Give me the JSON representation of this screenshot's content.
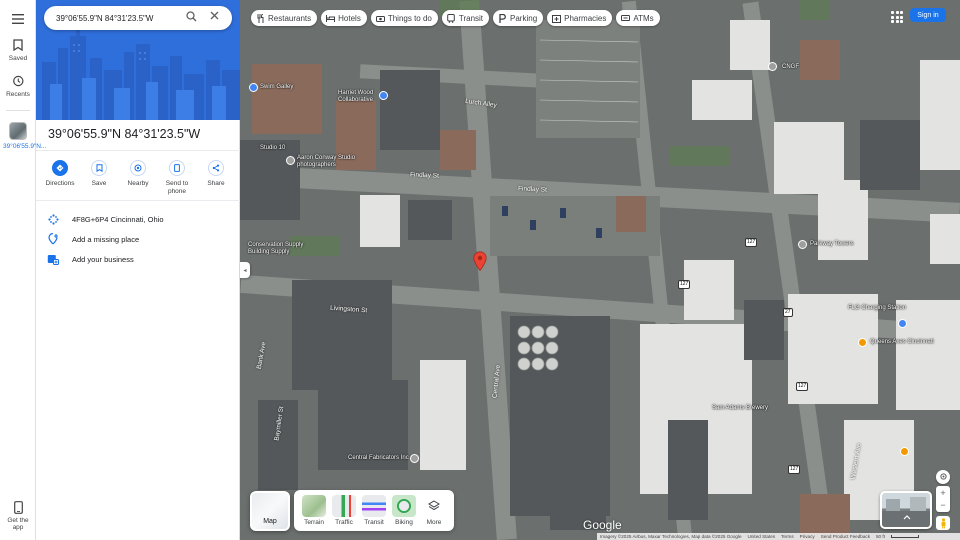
{
  "search": {
    "value": "39°06'55.9\"N 84°31'23.5\"W"
  },
  "rail": {
    "saved": "Saved",
    "recents": "Recents",
    "recent_item": "39°06'55.9\"N...",
    "get_app": "Get the app"
  },
  "place": {
    "title": "39°06'55.9\"N 84°31'23.5\"W",
    "actions": [
      {
        "label": "Directions",
        "icon": "directions-icon"
      },
      {
        "label": "Save",
        "icon": "bookmark-icon"
      },
      {
        "label": "Nearby",
        "icon": "nearby-icon"
      },
      {
        "label": "Send to phone",
        "icon": "phone-icon"
      },
      {
        "label": "Share",
        "icon": "share-icon"
      }
    ],
    "plus_code": "4F8G+6P4 Cincinnati, Ohio",
    "add_missing": "Add a missing place",
    "add_business": "Add your business"
  },
  "chips": [
    {
      "label": "Restaurants",
      "icon": "restaurant-icon"
    },
    {
      "label": "Hotels",
      "icon": "hotel-icon"
    },
    {
      "label": "Things to do",
      "icon": "camera-icon"
    },
    {
      "label": "Transit",
      "icon": "transit-icon"
    },
    {
      "label": "Parking",
      "icon": "parking-icon"
    },
    {
      "label": "Pharmacies",
      "icon": "pharmacy-icon"
    },
    {
      "label": "ATMs",
      "icon": "atm-icon"
    }
  ],
  "header": {
    "signin": "Sign in"
  },
  "layers": {
    "map": "Map",
    "items": [
      "Terrain",
      "Traffic",
      "Transit",
      "Biking",
      "More"
    ]
  },
  "map_labels": {
    "pois": [
      "Swim Galley",
      "Harriet Wood Collaborative",
      "Studio 10",
      "Aaron Conway Studio photographers",
      "Findlay St",
      "Lurch Alley",
      "CNGF",
      "Livingston St",
      "Central Ave",
      "Conservation Supply Building Supply",
      "Central Fabricators Inc",
      "Sam Adams Brewery",
      "FLG Charging Station",
      "Queens Axes Cincinnati",
      "Parkway Towers",
      "Bank Ave",
      "Baymiller St",
      "Western Ave"
    ],
    "shields": [
      "127",
      "127",
      "27",
      "127",
      "127"
    ]
  },
  "footer": {
    "google": "Google",
    "imagery": "Imagery ©2025 Airbus, Maxar Technologies, Map data ©2025 Google",
    "country": "United States",
    "terms": "Terms",
    "privacy": "Privacy",
    "feedback": "Send Product Feedback",
    "scale": "50 ft"
  },
  "colors": {
    "accent": "#1a73e8",
    "pin": "#ea4335",
    "hero": "#2f6fdc"
  }
}
